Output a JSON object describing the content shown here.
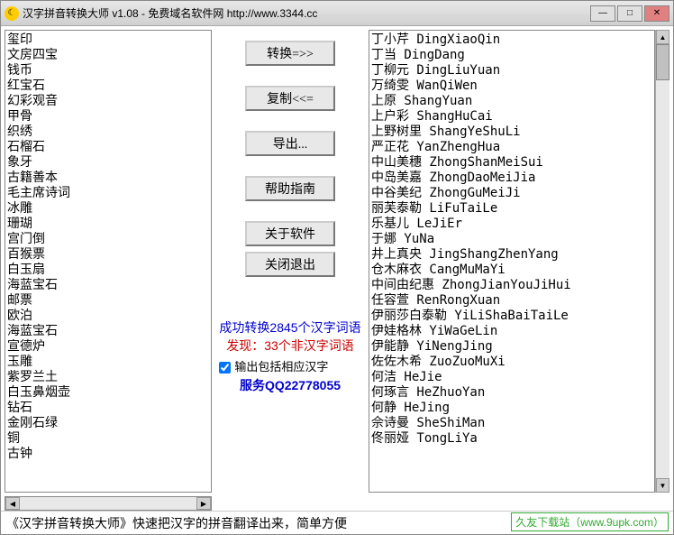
{
  "titlebar": {
    "icon": "☾",
    "text": "汉字拼音转换大师 v1.08 - 免费域名软件网 http://www.3344.cc"
  },
  "leftPanel": [
    "玺印",
    "文房四宝",
    "钱币",
    "红宝石",
    "幻彩观音",
    "甲骨",
    "织绣",
    "石榴石",
    "象牙",
    "古籍善本",
    "毛主席诗词",
    "冰雕",
    "珊瑚",
    "宫门倒",
    "百猴票",
    "白玉扇",
    "海蓝宝石",
    "邮票",
    "欧泊",
    "海蓝宝石",
    "宣德炉",
    "玉雕",
    "紫罗兰土",
    "白玉鼻烟壶",
    "钻石",
    "金刚石绿",
    "铜",
    "古钟"
  ],
  "buttons": {
    "convert": "转换=>>",
    "copy": "复制<<=",
    "export": "导出...",
    "help": "帮助指南",
    "about": "关于软件",
    "close": "关闭退出"
  },
  "status": {
    "success": "成功转换2845个汉字词语",
    "found": "发现：33个非汉字词语",
    "checkbox": "输出包括相应汉字",
    "qq": "服务QQ22778055"
  },
  "rightPanel": [
    "丁小芹 DingXiaoQin",
    "丁当 DingDang",
    "丁柳元 DingLiuYuan",
    "万绮雯 WanQiWen",
    "上原 ShangYuan",
    "上户彩 ShangHuCai",
    "上野树里 ShangYeShuLi",
    "严正花 YanZhengHua",
    "中山美穗 ZhongShanMeiSui",
    "中岛美嘉 ZhongDaoMeiJia",
    "中谷美纪 ZhongGuMeiJi",
    "丽芙泰勒 LiFuTaiLe",
    "乐基儿 LeJiEr",
    "于娜 YuNa",
    "井上真央 JingShangZhenYang",
    "仓木麻衣 CangMuMaYi",
    "中间由纪惠 ZhongJianYouJiHui",
    "任容萱 RenRongXuan",
    "伊丽莎白泰勒 YiLiShaBaiTaiLe",
    "伊娃格林 YiWaGeLin",
    "伊能静 YiNengJing",
    "佐佐木希 ZuoZuoMuXi",
    "何洁 HeJie",
    "何琢言 HeZhuoYan",
    "何静 HeJing",
    "佘诗曼 SheShiMan",
    "佟丽娅 TongLiYa"
  ],
  "bottom": {
    "text": "《汉字拼音转换大师》快速把汉字的拼音翻译出来，简单方便",
    "watermark": "久友下载站（www.9upk.com）"
  }
}
